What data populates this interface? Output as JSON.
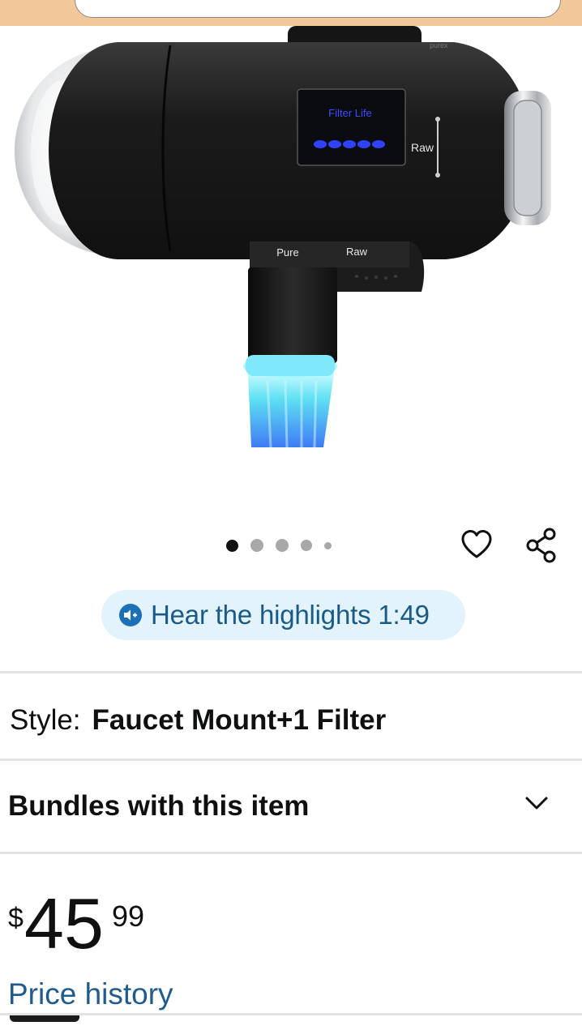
{
  "search": {
    "placeholder": ""
  },
  "product": {
    "image_alt": "Faucet mount water filter",
    "image_labels": {
      "filter_life": "Filter Life",
      "side_raw": "Raw",
      "toggle_pure": "Pure",
      "toggle_raw": "Raw",
      "brand": "purex"
    }
  },
  "carousel": {
    "dot_count": 5,
    "active_index": 0
  },
  "actions": {
    "favorite_icon": "heart-icon",
    "share_icon": "share-icon"
  },
  "highlights": {
    "label": "Hear the highlights",
    "duration": "1:49",
    "icon": "audio-icon"
  },
  "style": {
    "label": "Style:",
    "value": "Faucet Mount+1 Filter"
  },
  "bundles": {
    "label": "Bundles with this item",
    "icon": "chevron-down-icon"
  },
  "price": {
    "currency": "$",
    "whole": "45",
    "fraction": "99"
  },
  "price_history": {
    "label": "Price history"
  },
  "colors": {
    "link": "#1e5b8f",
    "pill_bg": "#e3f3fb",
    "pill_text": "#1a5a86",
    "divider": "#e2e4e4"
  }
}
